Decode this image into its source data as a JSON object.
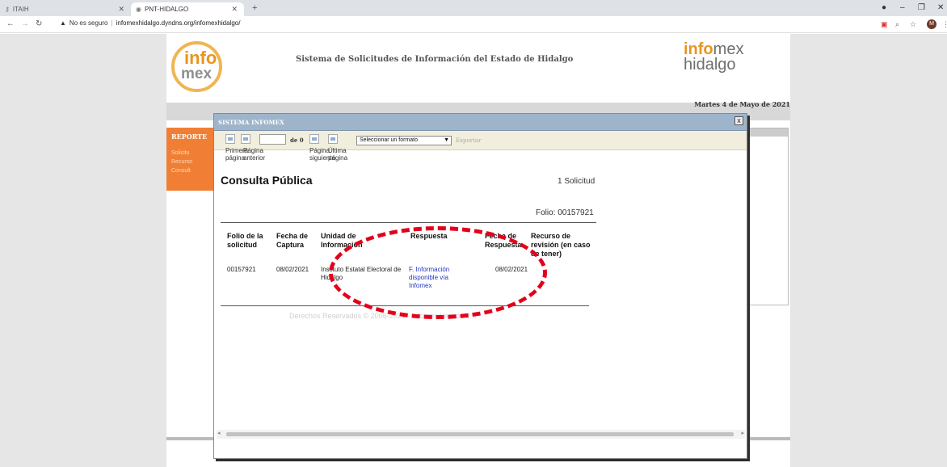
{
  "browser": {
    "tabs": [
      {
        "label": "ITAIH",
        "icon": "key-icon"
      },
      {
        "label": "PNT-HIDALGO",
        "icon": "globe-icon"
      }
    ],
    "security_label": "No es seguro",
    "url": "infomexhidalgo.dyndns.org/infomexhidalgo/",
    "profile_initial": "M"
  },
  "site": {
    "logo_left": {
      "line1": "info",
      "line2": "mex"
    },
    "title": "Sistema de Solicitudes de Información del Estado de Hidalgo",
    "logo_right": {
      "brand_bold": "info",
      "brand_rest": "mex",
      "line2": "hidalgo"
    },
    "date": "Martes 4 de Mayo de 2021",
    "sidebar": {
      "header": "REPORTE",
      "items": [
        "Solicitu",
        "Recurso",
        "Consult"
      ]
    }
  },
  "modal": {
    "title": "SISTEMA INFOMEX",
    "close_label": "x",
    "toolbar": {
      "first_page": "Primera página",
      "prev_page": "Página anterior",
      "page_value": "",
      "of_label": "de 0",
      "next_page": "Página siguiente",
      "last_page": "Última página",
      "format_select": "Seleccionar un formato",
      "export_label": "Exportar"
    },
    "report": {
      "title": "Consulta Pública",
      "count": "1 Solicitud",
      "folio": "Folio: 00157921",
      "columns": [
        "Folio de la solicitud",
        "Fecha de Captura",
        "Unidad de Información",
        "Respuesta",
        "Fecha de Respuesta",
        "Recurso de revisión (en caso de tener)"
      ],
      "rows": [
        {
          "folio": "00157921",
          "fecha_captura": "08/02/2021",
          "unidad": "Instituto Estatal Electoral de Hidalgo",
          "respuesta": "F. Información disponible vía Infomex",
          "fecha_respuesta": "08/02/2021",
          "recurso": ""
        }
      ],
      "footer": "Derechos Reservados © 2006-2021 - Infomex Versión 2.5"
    }
  },
  "annotation": {
    "color": "#e3001b",
    "shape": "dashed-ellipse"
  }
}
